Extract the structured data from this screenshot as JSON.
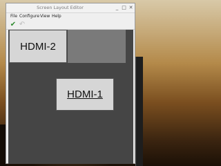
{
  "window": {
    "title": "Screen Layout Editor",
    "controls": {
      "minimize": "_",
      "maximize": "□",
      "close": "✕"
    }
  },
  "menubar": {
    "items": [
      "File",
      "Configure",
      "View",
      "Help"
    ]
  },
  "toolbar": {
    "apply_icon": "checkmark-icon",
    "apply_glyph": "✔",
    "apply_color": "#2e8b2e",
    "undo_icon": "undo-icon",
    "undo_glyph": "↶",
    "undo_color": "#bdbdbd"
  },
  "displays": {
    "primary": {
      "label": "HDMI-2"
    },
    "secondary": {
      "label": "HDMI-1"
    }
  },
  "colors": {
    "canvas": "#454545",
    "monitor": "#d6d6d6",
    "preview": "#7a7a7a"
  }
}
